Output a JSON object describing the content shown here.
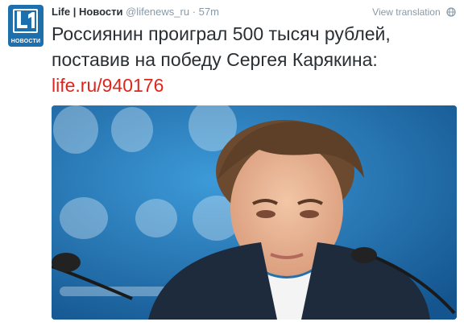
{
  "author": {
    "name": "Life | Новости",
    "handle": "@lifenews_ru",
    "separator": "·",
    "time": "57m",
    "avatar_label": "НОВОСТИ"
  },
  "actions": {
    "view_translation": "View translation",
    "translation_icon": "globe-icon"
  },
  "tweet": {
    "line1": "Россиянин проиграл 500 тысяч рублей,",
    "line2": "поставив на победу Сергея Карякина:",
    "link": "life.ru/940176"
  },
  "colors": {
    "link": "#e0251b",
    "avatar_bg": "#1d6fae",
    "meta": "#8899a6",
    "photo_bg": "#1a6fb4"
  }
}
